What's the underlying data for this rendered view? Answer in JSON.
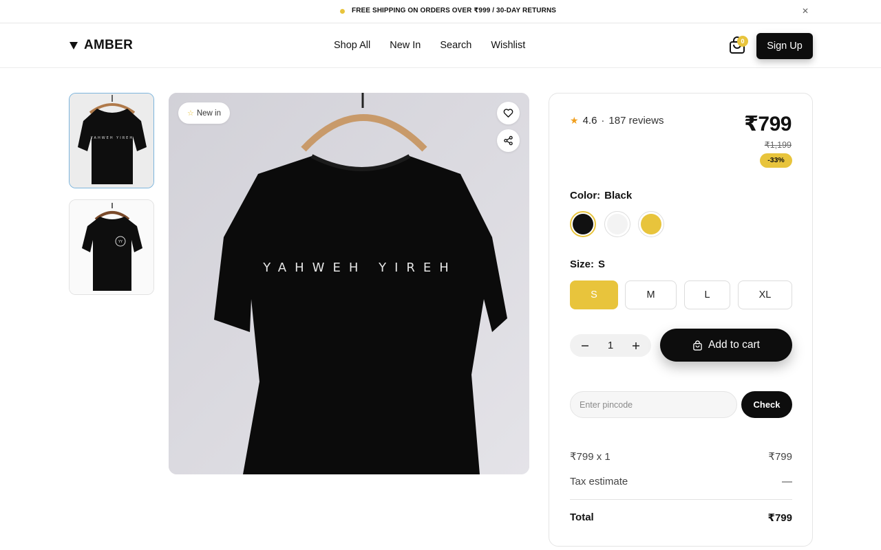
{
  "announcement": {
    "message": "FREE SHIPPING ON ORDERS OVER ₹999 / 30-DAY RETURNS",
    "close_icon": "close-icon",
    "accent": "#e8c43c"
  },
  "header": {
    "brand": "AMBER",
    "nav": [
      "Shop All",
      "New In",
      "Search",
      "Wishlist"
    ],
    "cart_count": "0",
    "signup_label": "Sign Up"
  },
  "gallery": {
    "thumbnails": [
      "front-view",
      "back-view"
    ],
    "main_print_text": "YAHWEH YIREH",
    "badge": "New in"
  },
  "product": {
    "rating": "4.6",
    "separator": "·",
    "reviews": "187 reviews",
    "price": "₹799",
    "mrp": "₹1,199",
    "discount": "-33%",
    "color_label": "Color:",
    "color_value": "Black",
    "colors": [
      {
        "name": "Black",
        "hex": "#111111",
        "selected": true
      },
      {
        "name": "White",
        "hex": "#f3f3f3",
        "selected": false
      },
      {
        "name": "Yellow",
        "hex": "#e8c43c",
        "selected": false
      }
    ],
    "size_label": "Size:",
    "size_value": "S",
    "sizes": [
      "S",
      "M",
      "L",
      "XL"
    ],
    "selected_size": "S",
    "quantity": "1",
    "add_to_cart": "Add to cart",
    "pincode_placeholder": "Enter pincode",
    "check_label": "Check"
  },
  "summary": {
    "line_label": "₹799 x 1",
    "line_value": "₹799",
    "tax_label": "Tax estimate",
    "tax_value": "—",
    "total_label": "Total",
    "total_value": "₹799"
  }
}
